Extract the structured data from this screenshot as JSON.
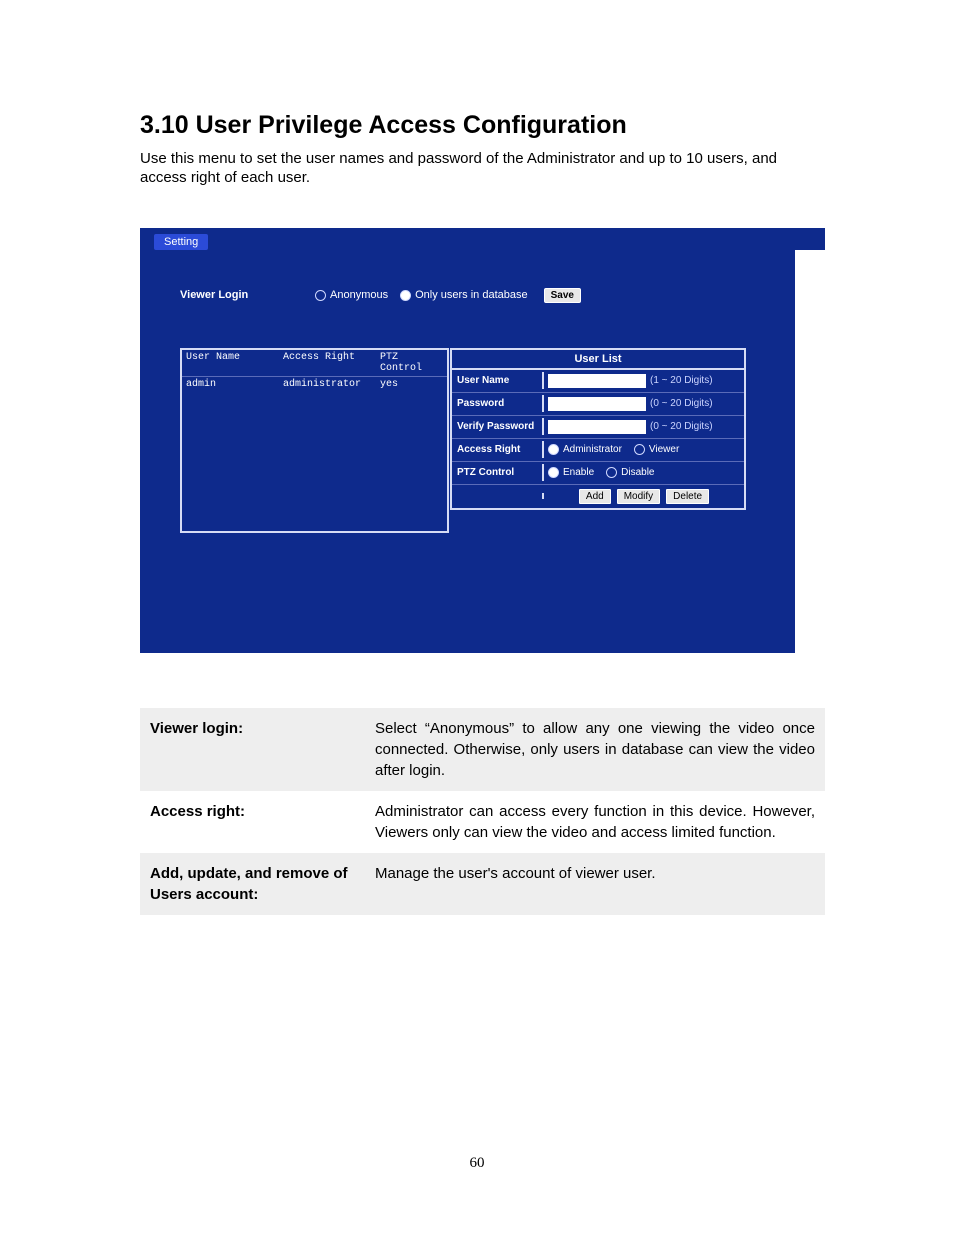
{
  "heading": "3.10 User Privilege Access Configuration",
  "intro": "Use this menu to set the user names and password of the Administrator and up to 10 users, and access right of each user.",
  "setting_tab": "Setting",
  "viewer_login": {
    "label": "Viewer Login",
    "opt_anonymous": "Anonymous",
    "opt_only_db": "Only users in database",
    "save": "Save"
  },
  "user_table": {
    "h_user": "User Name",
    "h_access": "Access Right",
    "h_ptz": "PTZ Control",
    "row": {
      "user": "admin",
      "access": "administrator",
      "ptz": "yes"
    }
  },
  "user_list": {
    "title": "User List",
    "f_user": "User Name",
    "f_pass": "Password",
    "f_vpass": "Verify Password",
    "f_access": "Access Right",
    "f_ptz": "PTZ Control",
    "hint_1_20": "(1 ~ 20 Digits)",
    "hint_0_20": "(0 ~ 20 Digits)",
    "opt_admin": "Administrator",
    "opt_viewer": "Viewer",
    "opt_enable": "Enable",
    "opt_disable": "Disable",
    "btn_add": "Add",
    "btn_modify": "Modify",
    "btn_delete": "Delete"
  },
  "desc": {
    "r1_label": "Viewer login:",
    "r1_value": "Select “Anonymous” to allow any one viewing the video once connected. Otherwise, only users in database can view the video after login.",
    "r2_label": "Access right:",
    "r2_value": "Administrator can access every function in this device. However, Viewers only can view the video and access limited function.",
    "r3_label": "Add, update, and remove of Users account:",
    "r3_value": "Manage the user's account of viewer user."
  },
  "page_number": "60"
}
